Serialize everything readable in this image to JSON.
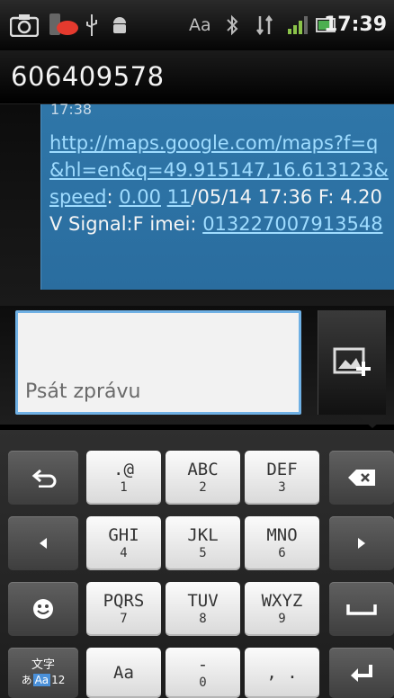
{
  "status_bar": {
    "clock": "17:39",
    "font_label": "Aa",
    "icons": [
      "camera-icon",
      "notification-icon",
      "usb-icon",
      "android-debug-icon",
      "bluetooth-icon",
      "data-transfer-icon",
      "signal-icon",
      "battery-icon"
    ]
  },
  "header": {
    "contact": "606409578"
  },
  "message": {
    "time": "17:38",
    "link": "http://maps.google.com/maps?f=q&hl=en&q=49.915147,16.613123&speed",
    "colon": ": ",
    "speed_link": "0.00",
    "date_link": "11",
    "rest": "/05/14 17:36 F: 4.20V  Signal:F imei: ",
    "imei_link": "013227007913548"
  },
  "compose": {
    "placeholder": "Psát zprávu"
  },
  "keyboard": {
    "keys": [
      {
        "main": ".@",
        "sub": "1"
      },
      {
        "main": "ABC",
        "sub": "2"
      },
      {
        "main": "DEF",
        "sub": "3"
      },
      {
        "main": "GHI",
        "sub": "4"
      },
      {
        "main": "JKL",
        "sub": "5"
      },
      {
        "main": "MNO",
        "sub": "6"
      },
      {
        "main": "PQRS",
        "sub": "7"
      },
      {
        "main": "TUV",
        "sub": "8"
      },
      {
        "main": "WXYZ",
        "sub": "9"
      },
      {
        "main": "Aa",
        "sub": ""
      },
      {
        "main": "-",
        "sub": "0"
      },
      {
        "main": ", .",
        "sub": ""
      }
    ],
    "mode_key": {
      "line1": "文字",
      "line2_a": "あ",
      "line2_b": "Aa",
      "line2_c": "12"
    }
  },
  "colors": {
    "bubble": "#2f76a8",
    "link": "#9fdcff",
    "input_border": "#6fb0e4"
  }
}
